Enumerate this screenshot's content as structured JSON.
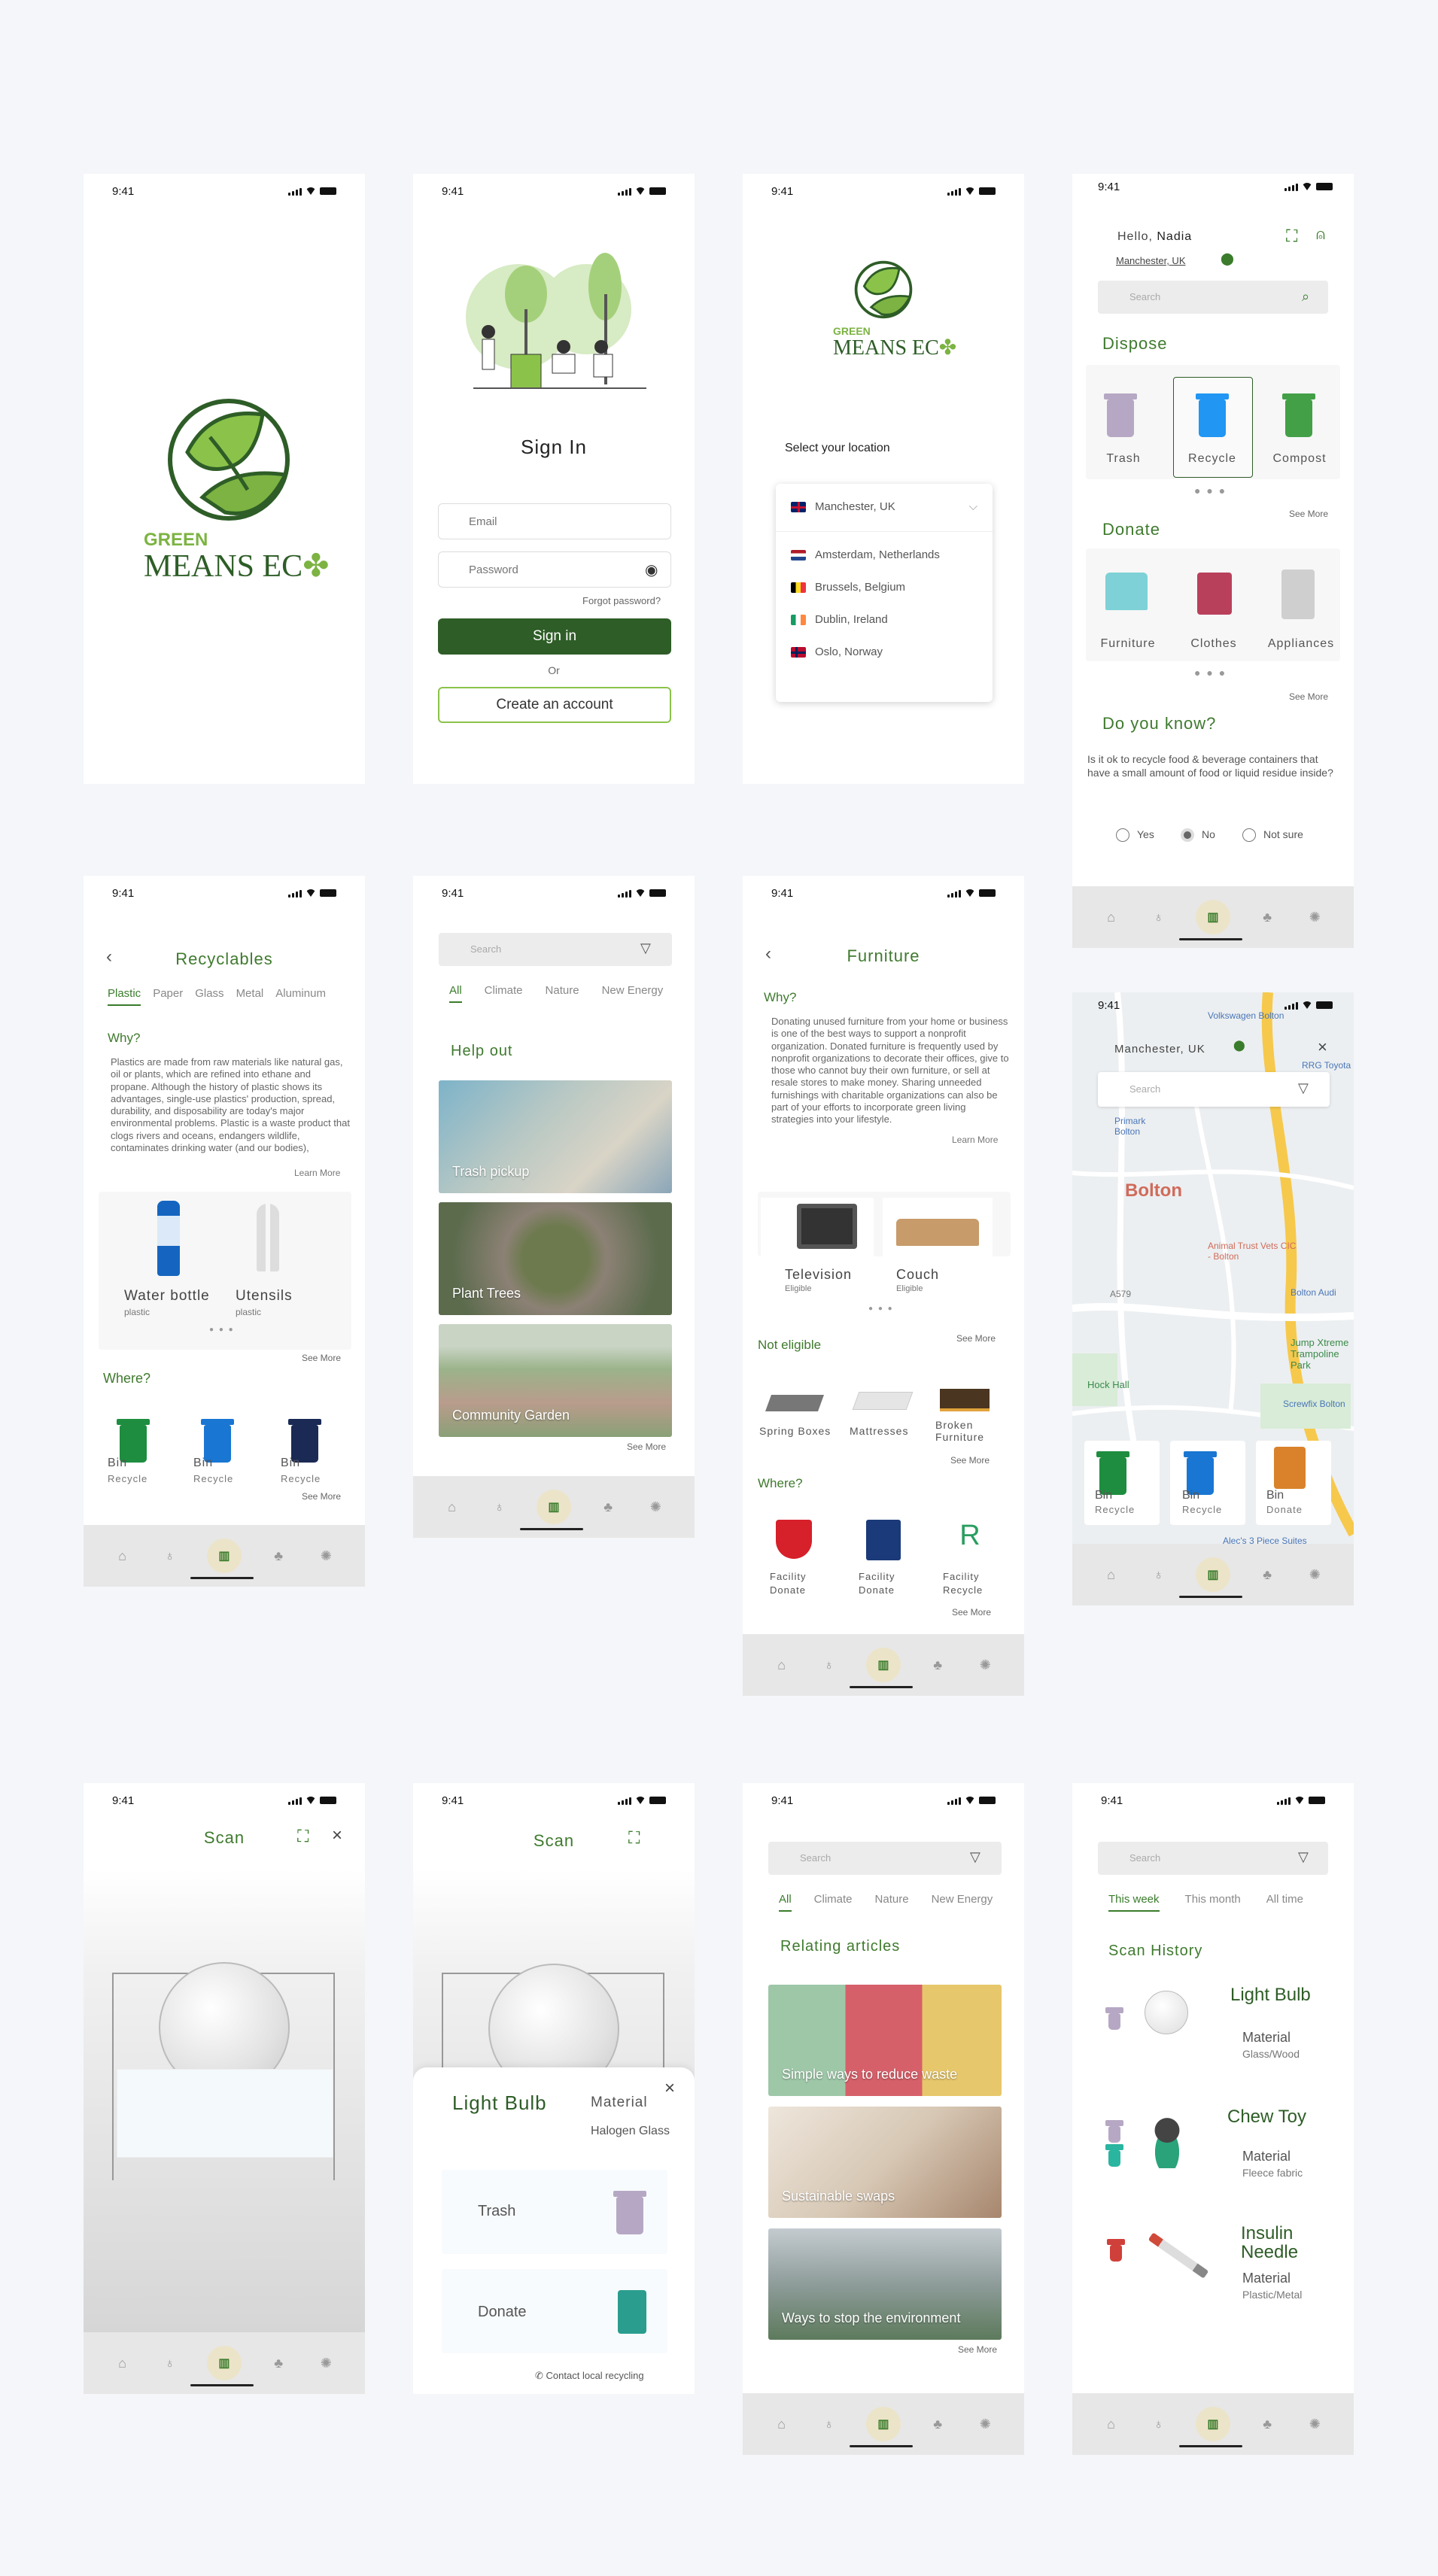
{
  "status": {
    "time": "9:41"
  },
  "splash": {
    "brand_top": "GREEN",
    "brand_bottom": "MEANS EC"
  },
  "signin": {
    "title": "Sign In",
    "email_placeholder": "Email",
    "password_placeholder": "Password",
    "forgot": "Forgot password?",
    "signin_button": "Sign in",
    "or": "Or",
    "create_button": "Create an account"
  },
  "location": {
    "brand_top": "GREEN",
    "brand_bottom": "MEANS EC",
    "prompt": "Select your location",
    "selected": "Manchester, UK",
    "options": [
      "Amsterdam, Netherlands",
      "Brussels, Belgium",
      "Dublin, Ireland",
      "Oslo, Norway"
    ]
  },
  "home": {
    "hello": "Hello,",
    "user": "Nadia",
    "location": "Manchester, UK",
    "search_placeholder": "Search",
    "dispose_title": "Dispose",
    "dispose_items": [
      "Trash",
      "Recycle",
      "Compost"
    ],
    "donate_title": "Donate",
    "donate_items": [
      "Furniture",
      "Clothes",
      "Appliances"
    ],
    "see_more": "See More",
    "dyk_title": "Do you know?",
    "dyk_question": "Is it ok to recycle food & beverage containers that have a small amount of food or liquid residue inside?",
    "answers": [
      "Yes",
      "No",
      "Not sure"
    ]
  },
  "recyclables": {
    "title": "Recyclables",
    "tabs": [
      "Plastic",
      "Paper",
      "Glass",
      "Metal",
      "Aluminum"
    ],
    "why": "Why?",
    "why_text": "Plastics are made from raw materials like natural gas, oil or plants, which are refined into ethane and propane. Although the history of plastic shows its advantages, single-use plastics' production, spread, durability, and disposability are today's major environmental problems. Plastic is a waste product that clogs rivers and oceans, endangers wildlife, contaminates drinking water (and our bodies),",
    "learn_more": "Learn More",
    "items": [
      {
        "name": "Water bottle",
        "type": "plastic"
      },
      {
        "name": "Utensils",
        "type": "plastic"
      }
    ],
    "see_more": "See More",
    "where": "Where?",
    "bins": [
      {
        "name": "Bin",
        "type": "Recycle"
      },
      {
        "name": "Bin",
        "type": "Recycle"
      },
      {
        "name": "Bin",
        "type": "Recycle"
      }
    ],
    "see_more2": "See More"
  },
  "helpout": {
    "search_placeholder": "Search",
    "tabs": [
      "All",
      "Climate",
      "Nature",
      "New Energy"
    ],
    "title": "Help out",
    "cards": [
      "Trash pickup",
      "Plant Trees",
      "Community Garden"
    ],
    "see_more": "See More"
  },
  "furniture": {
    "title": "Furniture",
    "why": "Why?",
    "why_text": "Donating unused furniture from your home or business is one of the best ways to support a nonprofit organization. Donated furniture is frequently used by nonprofit organizations to decorate their offices, give to those who cannot buy their own furniture, or sell at resale stores to make money. Sharing unneeded furnishings with charitable organizations can also be part of your efforts to incorporate green living strategies into your lifestyle.",
    "learn_more": "Learn More",
    "eligible": [
      {
        "name": "Television",
        "status": "Eligible"
      },
      {
        "name": "Couch",
        "status": "Eligible"
      }
    ],
    "see_more": "See More",
    "not_eligible_title": "Not eligible",
    "not_eligible": [
      "Spring Boxes",
      "Mattresses",
      "Broken Furniture"
    ],
    "see_more2": "See More",
    "where": "Where?",
    "facilities": [
      {
        "name": "Facility",
        "type": "Donate"
      },
      {
        "name": "Facility",
        "type": "Donate"
      },
      {
        "name": "Facility",
        "type": "Recycle"
      }
    ],
    "see_more3": "See More"
  },
  "map": {
    "location": "Manchester, UK",
    "search_placeholder": "Search",
    "labels": [
      "Bolton",
      "Primark Bolton",
      "Volkswagen Bolton",
      "Animal Trust Vets CIC - Bolton",
      "Jump Xtreme Trampoline Park",
      "Screwfix Bolton",
      "Alec's 3 Piece Suites",
      "A579",
      "Hock Hall",
      "RRG Toyota",
      "Bolton Audi"
    ],
    "bins": [
      {
        "name": "Bin",
        "type": "Recycle"
      },
      {
        "name": "Bin",
        "type": "Recycle"
      },
      {
        "name": "Bin",
        "type": "Donate"
      }
    ]
  },
  "scan1": {
    "title": "Scan"
  },
  "scan2": {
    "title": "Scan",
    "item": "Light Bulb",
    "material_label": "Material",
    "material": "Halogen Glass",
    "options": [
      "Trash",
      "Donate"
    ],
    "contact": "Contact local recycling"
  },
  "articles": {
    "search_placeholder": "Search",
    "tabs": [
      "All",
      "Climate",
      "Nature",
      "New Energy"
    ],
    "title": "Relating articles",
    "cards": [
      "Simple ways to reduce waste",
      "Sustainable swaps",
      "Ways to stop the environment"
    ],
    "see_more": "See More"
  },
  "history": {
    "search_placeholder": "Search",
    "tabs": [
      "This week",
      "This month",
      "All time"
    ],
    "title": "Scan History",
    "items": [
      {
        "name": "Light Bulb",
        "material_label": "Material",
        "material": "Glass/Wood"
      },
      {
        "name": "Chew Toy",
        "material_label": "Material",
        "material": "Fleece fabric"
      },
      {
        "name": "Insulin Needle",
        "material_label": "Material",
        "material": "Plastic/Metal"
      }
    ]
  }
}
